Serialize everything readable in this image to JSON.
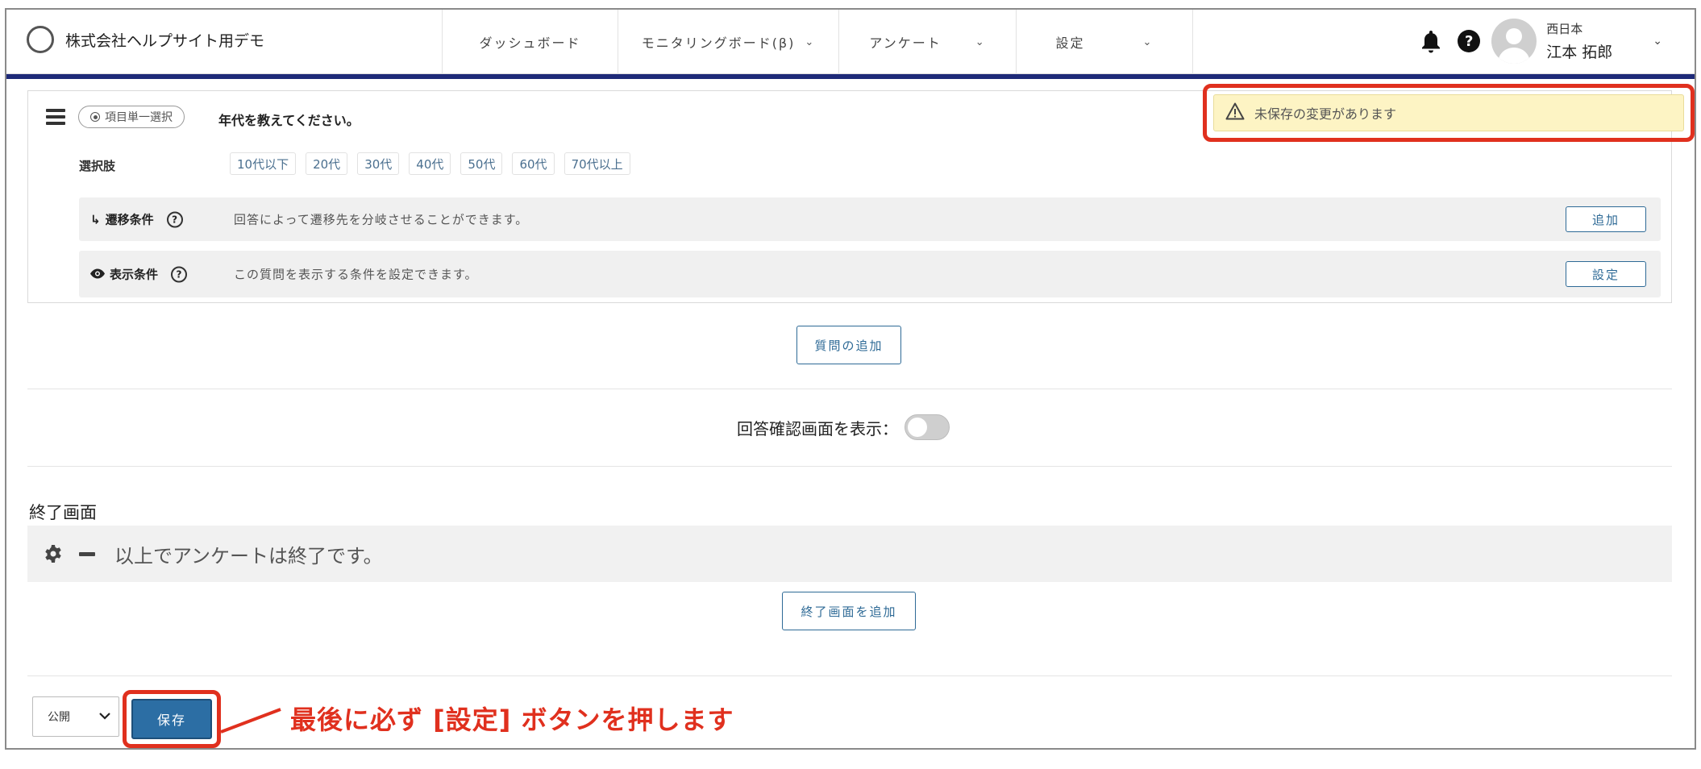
{
  "header": {
    "company": "株式会社ヘルプサイト用デモ",
    "nav": [
      {
        "label": "ダッシュボード",
        "has_dropdown": false
      },
      {
        "label": "モニタリングボード(β)",
        "has_dropdown": true
      },
      {
        "label": "アンケート",
        "has_dropdown": true
      },
      {
        "label": "設定",
        "has_dropdown": true
      }
    ],
    "icons": [
      "bell-icon",
      "help-icon",
      "avatar-icon"
    ],
    "user": {
      "org": "西日本",
      "name": "江本 拓郎"
    }
  },
  "notice": {
    "text": "未保存の変更があります",
    "icon": "warning-icon"
  },
  "question": {
    "type_label": "項目単一選択",
    "title": "年代を教えてください。",
    "choices_label": "選択肢",
    "choices": [
      "10代以下",
      "20代",
      "30代",
      "40代",
      "50代",
      "60代",
      "70代以上"
    ],
    "branch": {
      "label": "遷移条件",
      "desc": "回答によって遷移先を分岐させることができます。",
      "button": "追加"
    },
    "display": {
      "label": "表示条件",
      "desc": "この質問を表示する条件を設定できます。",
      "button": "設定"
    }
  },
  "add_question_label": "質問の追加",
  "confirm_label": "回答確認画面を表示：",
  "confirm_enabled": false,
  "end_screen": {
    "title": "終了画面",
    "message": "以上でアンケートは終了です。",
    "add_label": "終了画面を追加"
  },
  "footer": {
    "status_value": "公開",
    "save_label": "保存",
    "annotation": "最後に必ず [設定] ボタンを押します"
  },
  "colors": {
    "accent": "#2e6a96",
    "header_rule": "#1e2a78",
    "highlight": "#e0301e",
    "notice_bg": "#fdf4c4"
  }
}
